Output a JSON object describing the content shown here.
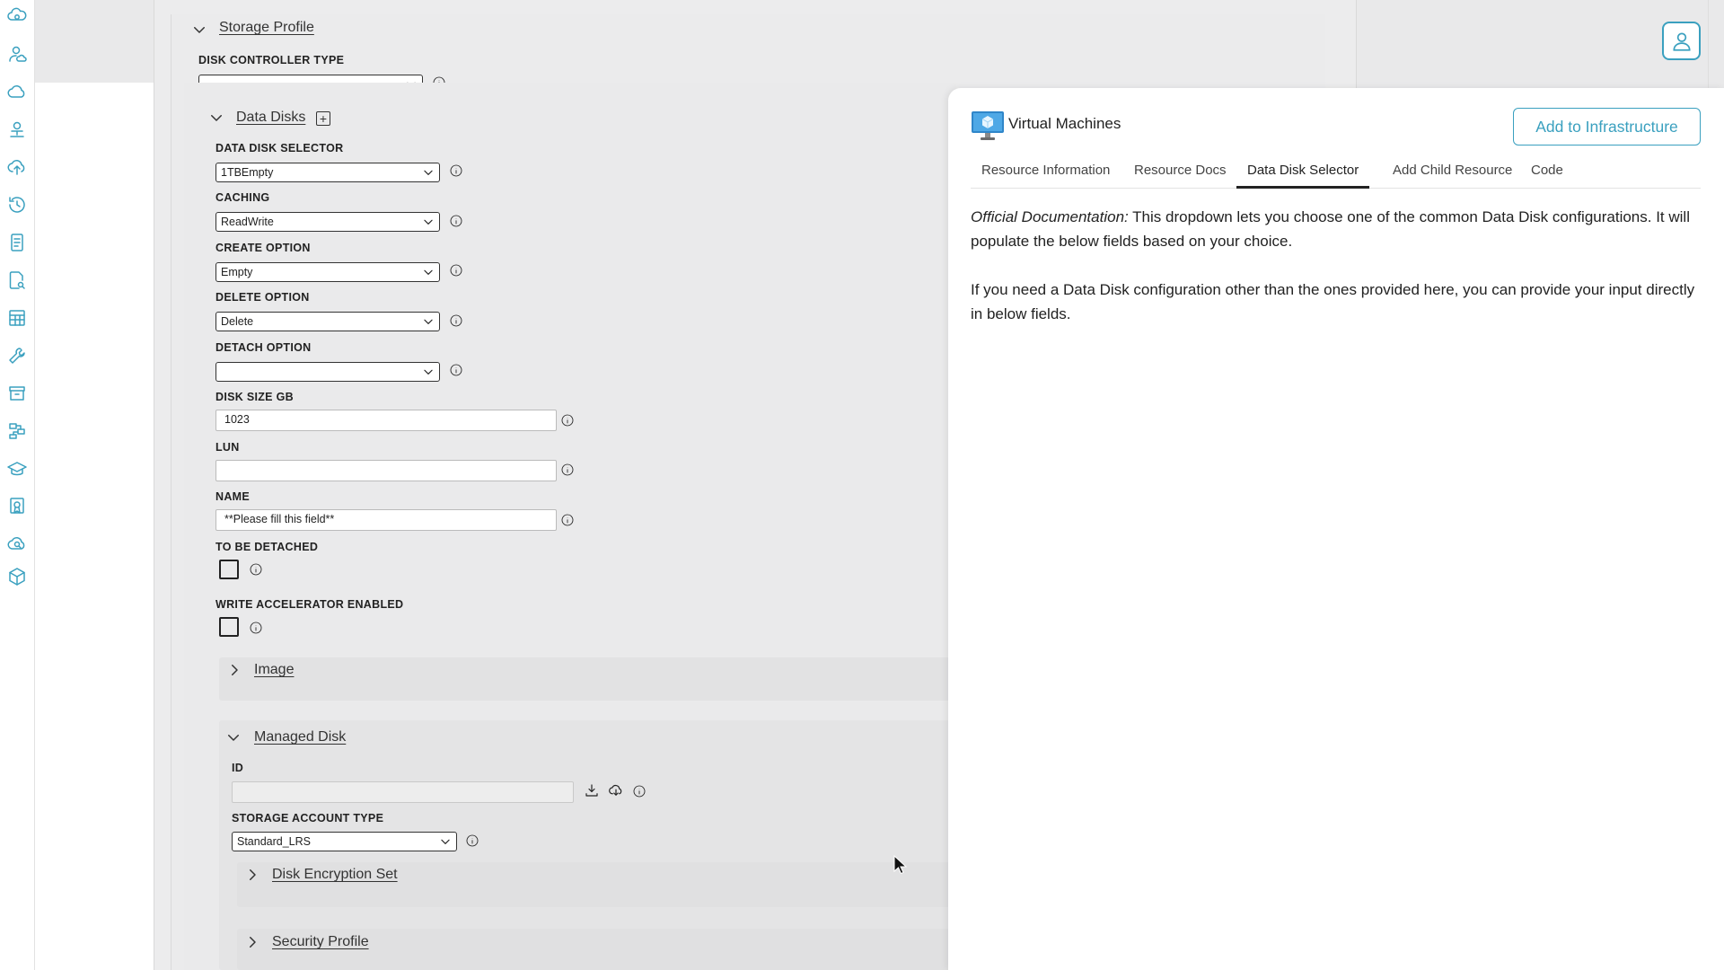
{
  "rail_icons": [
    "cloud-gear-icon",
    "user-cloud-icon",
    "cloud-icon",
    "network-user-icon",
    "cloud-upload-icon",
    "history-icon",
    "document-list-icon",
    "document-search-icon",
    "table-icon",
    "wrench-icon",
    "archive-icon",
    "workflow-icon",
    "graduation-cap-icon",
    "certificate-icon",
    "cloud-search-icon",
    "cube-3d-icon"
  ],
  "storage_profile": {
    "title": "Storage Profile",
    "disk_controller_type_label": "DISK CONTROLLER TYPE",
    "disk_controller_type_value": ""
  },
  "data_disks": {
    "title": "Data Disks",
    "data_disk_selector_label": "DATA DISK SELECTOR",
    "data_disk_selector_value": "1TBEmpty",
    "caching_label": "CACHING",
    "caching_value": "ReadWrite",
    "create_option_label": "CREATE OPTION",
    "create_option_value": "Empty",
    "delete_option_label": "DELETE OPTION",
    "delete_option_value": "Delete",
    "detach_option_label": "DETACH OPTION",
    "detach_option_value": "",
    "disk_size_label": "DISK SIZE GB",
    "disk_size_value": "1023",
    "lun_label": "LUN",
    "lun_value": "",
    "name_label": "NAME",
    "name_value": "**Please fill this field**",
    "to_be_detached_label": "TO BE DETACHED",
    "write_accel_label": "WRITE ACCELERATOR ENABLED"
  },
  "image": {
    "title": "Image"
  },
  "managed_disk": {
    "title": "Managed Disk",
    "id_label": "ID",
    "id_value": "",
    "storage_account_type_label": "STORAGE ACCOUNT TYPE",
    "storage_account_type_value": "Standard_LRS"
  },
  "disk_encryption_set": {
    "title": "Disk Encryption Set"
  },
  "security_profile": {
    "title": "Security Profile"
  },
  "panel": {
    "title": "Virtual Machines",
    "add_button": "Add to Infrastructure",
    "tabs": [
      "Resource Information",
      "Resource Docs",
      "Data Disk Selector",
      "Add Child Resource",
      "Code"
    ],
    "active_tab": "Data Disk Selector",
    "doc_prefix": "Official Documentation:",
    "doc_p1": " This dropdown lets you choose one of the common Data Disk configurations. It will populate the below fields based on your choice.",
    "doc_p2": "If you need a Data Disk configuration other than the ones provided here, you can provide your input directly in below fields."
  },
  "colors": {
    "accent": "#3aa0bf",
    "panel_bg": "#ffffff",
    "page_bg": "#e9e9ea"
  }
}
